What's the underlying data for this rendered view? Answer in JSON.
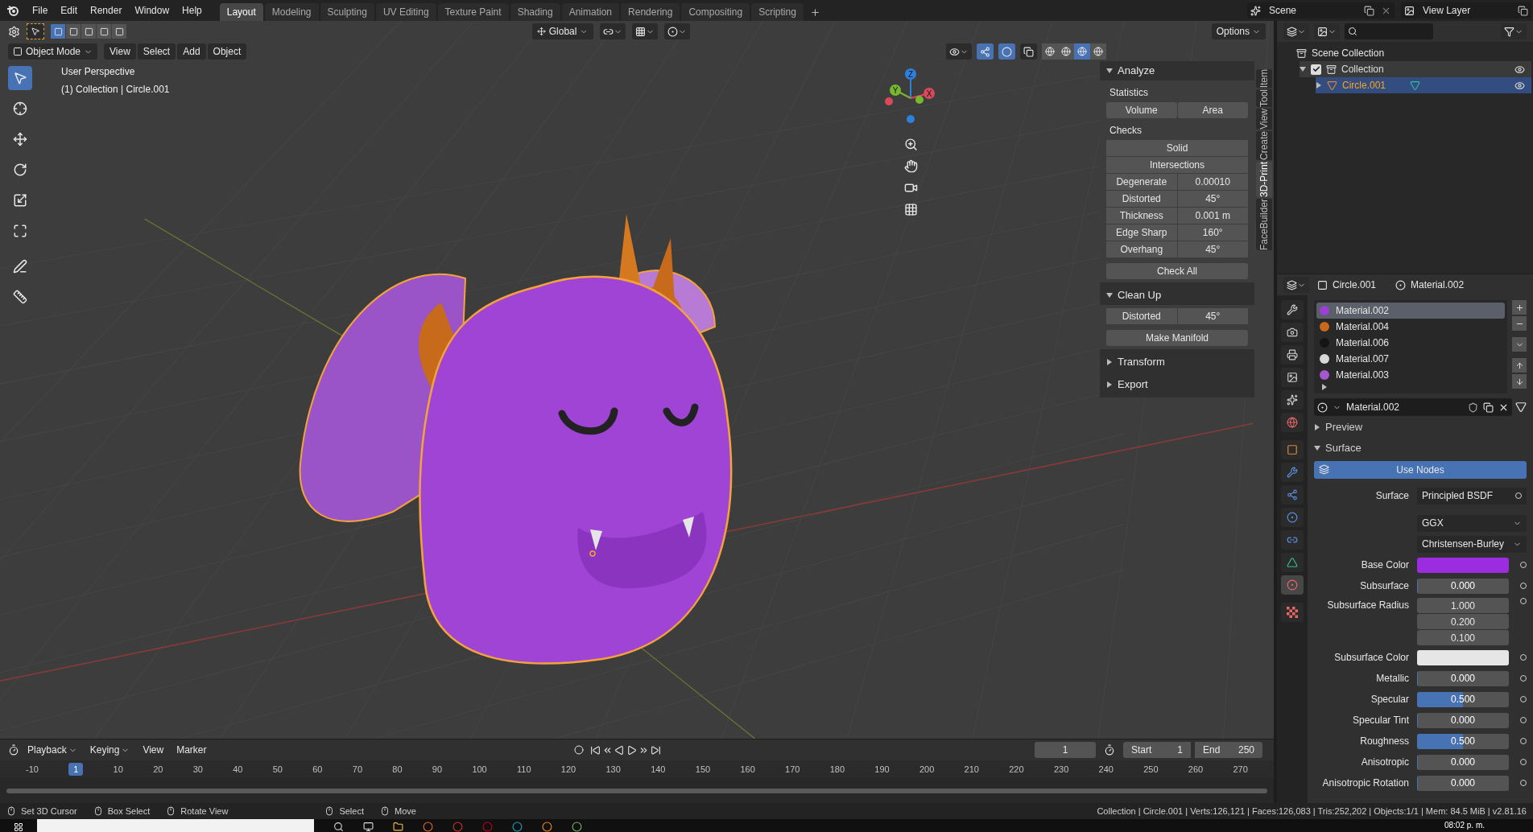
{
  "menu": [
    "File",
    "Edit",
    "Render",
    "Window",
    "Help"
  ],
  "workspaces": [
    {
      "label": "Layout",
      "selected": true
    },
    {
      "label": "Modeling",
      "selected": false
    },
    {
      "label": "Sculpting",
      "selected": false
    },
    {
      "label": "UV Editing",
      "selected": false
    },
    {
      "label": "Texture Paint",
      "selected": false
    },
    {
      "label": "Shading",
      "selected": false
    },
    {
      "label": "Animation",
      "selected": false
    },
    {
      "label": "Rendering",
      "selected": false
    },
    {
      "label": "Compositing",
      "selected": false
    },
    {
      "label": "Scripting",
      "selected": false
    }
  ],
  "scene": "Scene",
  "view_layer": "View Layer",
  "viewport": {
    "orientation": "Global",
    "options": "Options",
    "mode": "Object Mode",
    "menus": [
      "View",
      "Select",
      "Add",
      "Object"
    ],
    "overlay_title": "User Perspective",
    "overlay_subtitle": "(1) Collection | Circle.001",
    "axes": [
      "X",
      "Y",
      "Z"
    ],
    "tools": [
      {
        "kind": "select",
        "selected": true
      },
      {
        "kind": "cursor",
        "selected": false
      },
      {
        "kind": "move",
        "selected": false
      },
      {
        "kind": "rotate",
        "selected": false
      },
      {
        "kind": "scale",
        "selected": false
      },
      {
        "kind": "transform",
        "selected": false
      },
      {
        "kind": "annotate",
        "selected": false
      },
      {
        "kind": "measure",
        "selected": false
      }
    ]
  },
  "sidebar": {
    "tabs": [
      {
        "label": "Item",
        "selected": false
      },
      {
        "label": "Tool",
        "selected": false
      },
      {
        "label": "View",
        "selected": false
      },
      {
        "label": "Create",
        "selected": false
      },
      {
        "label": "3D-Print",
        "selected": true
      },
      {
        "label": "FaceBuilder",
        "selected": false
      }
    ],
    "panels": [
      {
        "title": "Analyze",
        "expanded": true,
        "rows": [
          {
            "kind": "heading",
            "label": "Statistics"
          },
          {
            "kind": "pair",
            "buttons": [
              "Volume",
              "Area"
            ]
          },
          {
            "kind": "heading",
            "label": "Checks"
          },
          {
            "kind": "button",
            "label": "Solid"
          },
          {
            "kind": "button",
            "label": "Intersections"
          },
          {
            "kind": "prop",
            "label": "Degenerate",
            "value": "0.00010"
          },
          {
            "kind": "prop",
            "label": "Distorted",
            "value": "45°"
          },
          {
            "kind": "prop",
            "label": "Thickness",
            "value": "0.001 m"
          },
          {
            "kind": "prop",
            "label": "Edge Sharp",
            "value": "160°"
          },
          {
            "kind": "prop",
            "label": "Overhang",
            "value": "45°"
          },
          {
            "kind": "action",
            "label": "Check All"
          }
        ]
      },
      {
        "title": "Clean Up",
        "expanded": true,
        "rows": [
          {
            "kind": "prop",
            "label": "Distorted",
            "value": "45°"
          },
          {
            "kind": "action",
            "label": "Make Manifold"
          }
        ]
      },
      {
        "title": "Transform",
        "expanded": false
      },
      {
        "title": "Export",
        "expanded": false
      }
    ]
  },
  "outliner": {
    "root": "Scene Collection",
    "tree": [
      {
        "name": "Collection",
        "kind": "collection",
        "checked": true,
        "expanded": true,
        "selected": false,
        "children": [
          {
            "name": "Circle.001",
            "kind": "mesh",
            "expanded": false,
            "selected": true
          }
        ]
      }
    ]
  },
  "properties": {
    "object": "Circle.001",
    "material": "Material.002",
    "tabs": [
      {
        "kind": "tool",
        "selected": false
      },
      {
        "kind": "render",
        "selected": false
      },
      {
        "kind": "output",
        "selected": false
      },
      {
        "kind": "view_layer",
        "selected": false
      },
      {
        "kind": "scene",
        "selected": false
      },
      {
        "kind": "world",
        "selected": false
      },
      {
        "kind": "object",
        "selected": false
      },
      {
        "kind": "modifiers",
        "selected": false
      },
      {
        "kind": "particles",
        "selected": false
      },
      {
        "kind": "physics",
        "selected": false
      },
      {
        "kind": "constraints",
        "selected": false
      },
      {
        "kind": "data",
        "selected": false
      },
      {
        "kind": "material",
        "selected": true
      },
      {
        "kind": "texture",
        "selected": false
      }
    ],
    "slots": [
      {
        "name": "Material.002",
        "color": "#9b3fd6",
        "selected": true
      },
      {
        "name": "Material.004",
        "color": "#c8691b",
        "selected": false
      },
      {
        "name": "Material.006",
        "color": "#151515",
        "selected": false
      },
      {
        "name": "Material.007",
        "color": "#d8d8d8",
        "selected": false
      },
      {
        "name": "Material.003",
        "color": "#a458d0",
        "selected": false
      }
    ],
    "material_name": "Material.002",
    "sections": [
      {
        "title": "Preview",
        "expanded": false
      },
      {
        "title": "Surface",
        "expanded": true
      }
    ],
    "use_nodes": {
      "label": "Use Nodes",
      "on": true
    },
    "rows": [
      {
        "kind": "dropdown",
        "label": "Surface",
        "value": "Principled BSDF"
      },
      {
        "kind": "dropdown",
        "value": "GGX"
      },
      {
        "kind": "dropdown",
        "value": "Christensen-Burley"
      },
      {
        "kind": "color",
        "label": "Base Color",
        "color": "#9b2ce0"
      },
      {
        "kind": "number",
        "label": "Subsurface",
        "value": "0.000",
        "level": 0
      },
      {
        "kind": "vector",
        "label": "Subsurface Radius",
        "values": [
          "1.000",
          "0.200",
          "0.100"
        ]
      },
      {
        "kind": "color",
        "label": "Subsurface Color",
        "color": "#e6e6e6"
      },
      {
        "kind": "number",
        "label": "Metallic",
        "value": "0.000",
        "level": 0
      },
      {
        "kind": "number",
        "label": "Specular",
        "value": "0.500",
        "level": 0.5
      },
      {
        "kind": "number",
        "label": "Specular Tint",
        "value": "0.000",
        "level": 0
      },
      {
        "kind": "number",
        "label": "Roughness",
        "value": "0.500",
        "level": 0.5
      },
      {
        "kind": "number",
        "label": "Anisotropic",
        "value": "0.000",
        "level": 0
      },
      {
        "kind": "number",
        "label": "Anisotropic Rotation",
        "value": "0.000",
        "level": 0
      }
    ]
  },
  "timeline": {
    "menus": [
      "Playback",
      "Keying",
      "View",
      "Marker"
    ],
    "frame": "1",
    "start_label": "Start",
    "start": "1",
    "end_label": "End",
    "end": "250",
    "ruler": [
      {
        "label": "-10",
        "current": false
      },
      {
        "label": "1",
        "current": true
      },
      {
        "label": "10",
        "current": false
      },
      {
        "label": "20",
        "current": false
      },
      {
        "label": "30",
        "current": false
      },
      {
        "label": "40",
        "current": false
      },
      {
        "label": "50",
        "current": false
      },
      {
        "label": "60",
        "current": false
      },
      {
        "label": "70",
        "current": false
      },
      {
        "label": "80",
        "current": false
      },
      {
        "label": "90",
        "current": false
      },
      {
        "label": "100",
        "current": false
      },
      {
        "label": "110",
        "current": false
      },
      {
        "label": "120",
        "current": false
      },
      {
        "label": "130",
        "current": false
      },
      {
        "label": "140",
        "current": false
      },
      {
        "label": "150",
        "current": false
      },
      {
        "label": "160",
        "current": false
      },
      {
        "label": "170",
        "current": false
      },
      {
        "label": "180",
        "current": false
      },
      {
        "label": "190",
        "current": false
      },
      {
        "label": "200",
        "current": false
      },
      {
        "label": "210",
        "current": false
      },
      {
        "label": "220",
        "current": false
      },
      {
        "label": "230",
        "current": false
      },
      {
        "label": "240",
        "current": false
      },
      {
        "label": "250",
        "current": false
      },
      {
        "label": "260",
        "current": false
      },
      {
        "label": "270",
        "current": false
      }
    ]
  },
  "status": {
    "hints": [
      {
        "label": "Set 3D Cursor"
      },
      {
        "label": "Box Select"
      },
      {
        "label": "Rotate View"
      },
      {
        "label": "Select"
      },
      {
        "label": "Move"
      }
    ],
    "info": "Collection | Circle.001 | Verts:126,121 | Faces:126,083 | Tris:252,202 | Objects:1/1 | Mem: 84.5 MiB | v2.81.16"
  },
  "taskbar": {
    "time": "08:02 p. m."
  }
}
